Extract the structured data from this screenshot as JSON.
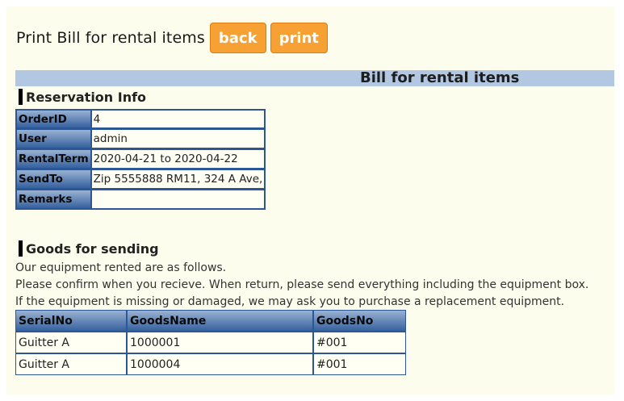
{
  "header": {
    "title": "Print Bill for rental items",
    "back_label": "back",
    "print_label": "print"
  },
  "banner": {
    "title": "Bill for rental items"
  },
  "reservation": {
    "heading": "Reservation Info",
    "rows": [
      {
        "label": "OrderID",
        "value": "4"
      },
      {
        "label": "User",
        "value": "admin"
      },
      {
        "label": "RentalTerm",
        "value": "2020-04-21 to 2020-04-22"
      },
      {
        "label": "SendTo",
        "value": "Zip 5555888 RM11, 324 A Ave,"
      },
      {
        "label": "Remarks",
        "value": ""
      }
    ]
  },
  "goods": {
    "heading": "Goods for sending",
    "notes": [
      "Our equipment rented are as follows.",
      "Please confirm when you recieve. When return, please send everything including the equipment box.",
      "If the equipment is missing or damaged, we may ask you to purchase a replacement equipment."
    ],
    "columns": [
      "SerialNo",
      "GoodsName",
      "GoodsNo"
    ],
    "rows": [
      [
        "Guitter A",
        "1000001",
        "#001"
      ],
      [
        "Guitter A",
        "1000004",
        "#001"
      ]
    ]
  },
  "colors": {
    "button": "#f7a135",
    "banner": "#b1c7e2",
    "table_header": "#36619e",
    "background": "#fdfdee"
  }
}
